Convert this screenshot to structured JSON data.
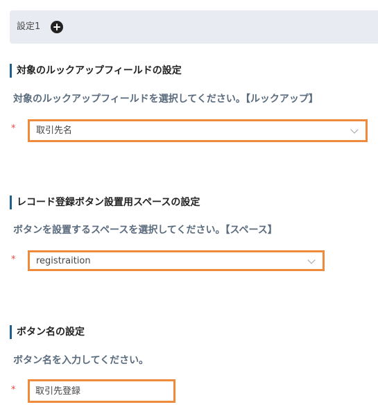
{
  "tab": {
    "label": "設定1",
    "add_icon": "plus-circle-icon"
  },
  "sections": [
    {
      "heading": "対象のルックアップフィールドの設定",
      "description": "対象のルックアップフィールドを選択してください。【ルックアップ】",
      "required_mark": "*",
      "selected_value": "取引先名"
    },
    {
      "heading": "レコード登録ボタン設置用スペースの設定",
      "description": "ボタンを設置するスペースを選択してください。【スペース】",
      "required_mark": "*",
      "selected_value": "registraition"
    },
    {
      "heading": "ボタン名の設定",
      "description": "ボタン名を入力してください。",
      "required_mark": "*",
      "input_value": "取引先登録"
    }
  ],
  "colors": {
    "accent_border": "#ef8a3c",
    "heading_bar": "#1f5f8b",
    "required": "#e74c3c",
    "tab_background": "#e9ebf2"
  }
}
